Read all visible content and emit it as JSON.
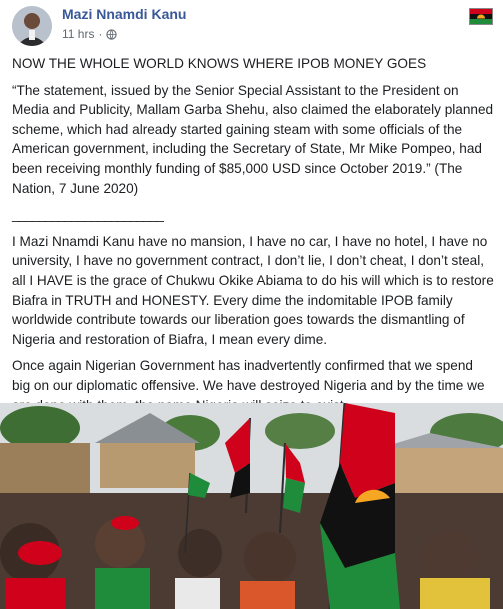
{
  "post": {
    "author": "Mazi Nnamdi Kanu",
    "timestamp": "11 hrs",
    "separator": "·",
    "privacy_icon": "globe-icon",
    "headline": "NOW THE WHOLE WORLD KNOWS WHERE IPOB MONEY GOES",
    "quote": "“The statement, issued by the Senior Special Assistant to the President on Media and Publicity, Mallam Garba Shehu, also claimed the elaborately planned scheme, which had already started gaining steam with some officials of the American government, including the Secretary of State, Mr Mike Pompeo, had been receiving monthly funding of $85,000 USD since October 2019.” (The Nation, 7 June 2020)",
    "divider": "_______________________",
    "paragraph1": "I Mazi Nnamdi Kanu have no mansion, I have no car, I have no hotel, I have no university, I have no government contract, I don’t lie, I don’t cheat, I don’t steal, all I HAVE is the grace of Chukwu Okike Abiama to do his will which is to restore Biafra in TRUTH and HONESTY. Every dime the indomitable IPOB family worldwide contribute towards our liberation goes towards the dismantling of Nigeria and restoration of Biafra, I mean every dime.",
    "paragraph2": "Once again Nigerian Government has inadvertently confirmed that we spend big on our diplomatic offensive. We have destroyed Nigeria and by the time we are done with them, the name Nigeria will seize to exist."
  },
  "colors": {
    "author": "#385898",
    "meta": "#606770",
    "text": "#1c1e21",
    "flag_red": "#d0021b",
    "flag_black": "#111111",
    "flag_green": "#1e8c3a"
  }
}
